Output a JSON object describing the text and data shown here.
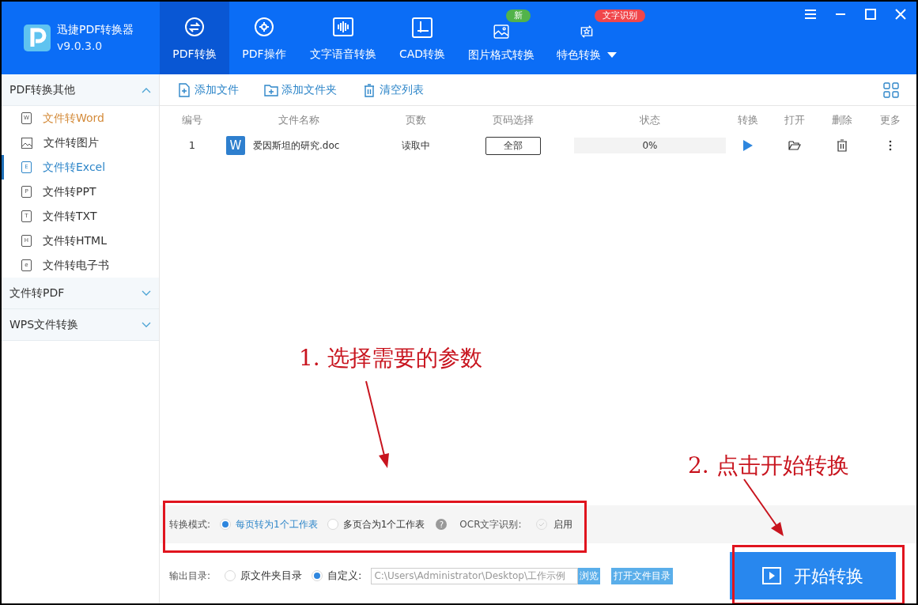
{
  "app": {
    "name": "迅捷PDF转换器",
    "version": "v9.0.3.0"
  },
  "tabs": [
    {
      "label": "PDF转换",
      "selected": true
    },
    {
      "label": "PDF操作",
      "selected": false
    },
    {
      "label": "文字语音转换",
      "selected": false
    },
    {
      "label": "CAD转换",
      "selected": false
    },
    {
      "label": "图片格式转换",
      "selected": false,
      "badge": {
        "text": "新",
        "color": "#52b34a"
      }
    },
    {
      "label": "特色转换",
      "selected": false,
      "badge": {
        "text": "文字识别",
        "color": "#f0464b"
      },
      "dropdown": true
    }
  ],
  "sidebar": {
    "groups": [
      {
        "title": "PDF转换其他",
        "expanded": true,
        "items": [
          {
            "label": "文件转Word",
            "icon_letter": "W",
            "selected": false,
            "hovered": true
          },
          {
            "label": "文件转图片",
            "selected": false,
            "hovered": false
          },
          {
            "label": "文件转Excel",
            "icon_letter": "E",
            "selected": true,
            "hovered": false
          },
          {
            "label": "文件转PPT",
            "icon_letter": "P",
            "selected": false,
            "hovered": false
          },
          {
            "label": "文件转TXT",
            "icon_letter": "T",
            "selected": false,
            "hovered": false
          },
          {
            "label": "文件转HTML",
            "icon_letter": "H",
            "selected": false,
            "hovered": false
          },
          {
            "label": "文件转电子书",
            "icon_letter": "e",
            "selected": false,
            "hovered": false
          }
        ]
      },
      {
        "title": "文件转PDF",
        "expanded": false
      },
      {
        "title": "WPS文件转换",
        "expanded": false
      }
    ]
  },
  "toolbar": [
    {
      "label": "添加文件"
    },
    {
      "label": "添加文件夹"
    },
    {
      "label": "清空列表"
    }
  ],
  "table": {
    "columns": [
      "编号",
      "文件名称",
      "页数",
      "页码选择",
      "状态",
      "转换",
      "打开",
      "删除",
      "更多"
    ],
    "rows": [
      {
        "number": "1",
        "file_icon": "W",
        "name": "爱因斯坦的研究.doc",
        "pages": "读取中",
        "page_select": "全部",
        "level": 0,
        "status": "0%"
      }
    ]
  },
  "options": {
    "label": "转换模式:",
    "modes": [
      {
        "label": "每页转为1个工作表",
        "selected": true
      },
      {
        "label": "多页合为1个工作表",
        "selected": false
      }
    ],
    "help": "?",
    "ocr_label": "OCR文字识别:",
    "ocr": {
      "label": "启用",
      "checked": false
    }
  },
  "output": {
    "label": "输出目录:",
    "choices": [
      {
        "label": "原文件夹目录",
        "selected": false
      },
      {
        "label": "自定义:",
        "selected": true
      }
    ],
    "path": "C:\\Users\\Administrator\\Desktop\\工作示例",
    "browse": "浏览",
    "open_folder": "打开文件目录"
  },
  "start_button": "开始转换",
  "annotations": [
    {
      "text": "1. 选择需要的参数"
    },
    {
      "text": "2. 点击开始转换"
    }
  ]
}
